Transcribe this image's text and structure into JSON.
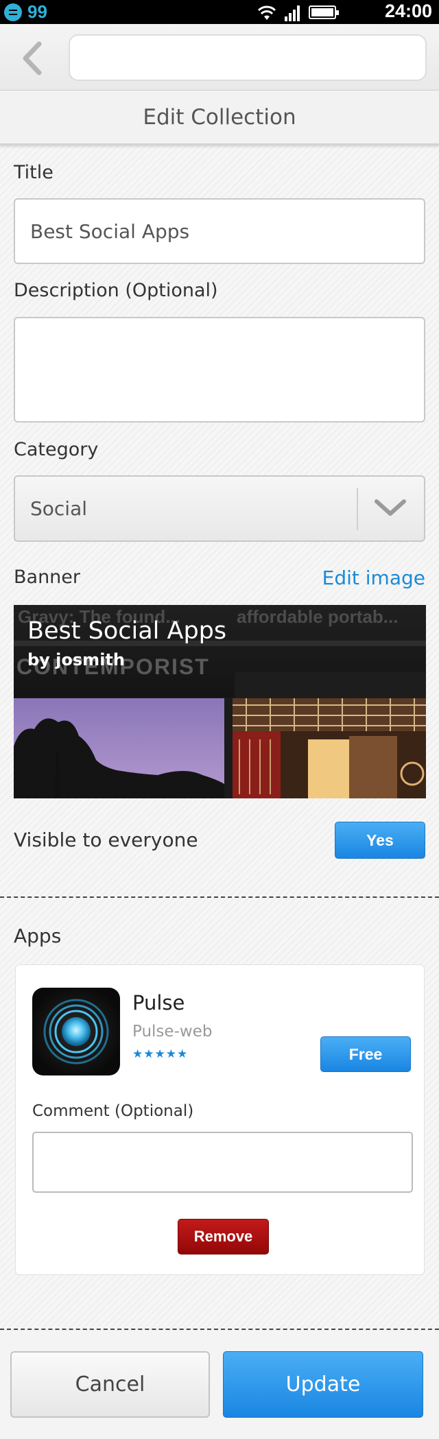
{
  "status_bar": {
    "notification_count": "99",
    "time": "24:00",
    "icons": [
      "wifi-icon",
      "signal-icon",
      "battery-icon"
    ]
  },
  "browser": {
    "url_value": ""
  },
  "header": {
    "title": "Edit Collection"
  },
  "form": {
    "title_label": "Title",
    "title_value": "Best Social Apps",
    "description_label": "Description (Optional)",
    "description_value": "",
    "category_label": "Category",
    "category_value": "Social",
    "banner_label": "Banner",
    "edit_image_link": "Edit image",
    "visible_label": "Visible to everyone",
    "visible_button": "Yes"
  },
  "banner": {
    "title": "Best Social Apps",
    "author": "by josmith",
    "bg_text_1": "Gravy: The found...",
    "bg_text_2": "affordable portab...",
    "bg_text_3": "CONTEMPORIST"
  },
  "apps_section": {
    "label": "Apps",
    "items": [
      {
        "name": "Pulse",
        "developer": "Pulse-web",
        "rating": 5,
        "stars": "★★★★★",
        "price_button": "Free",
        "comment_label": "Comment (Optional)",
        "comment_value": "",
        "remove_button": "Remove"
      }
    ]
  },
  "footer": {
    "cancel_label": "Cancel",
    "update_label": "Update"
  },
  "colors": {
    "accent_blue": "#1a86e2",
    "link_blue": "#1a8ad6",
    "danger_red": "#b31111"
  }
}
